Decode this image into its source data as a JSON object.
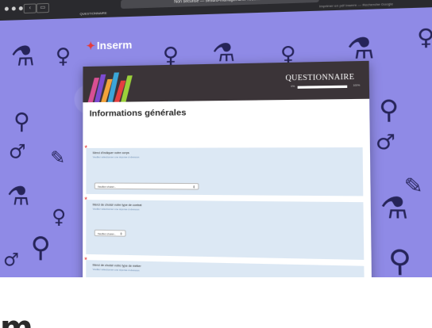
{
  "browser": {
    "url": "Non sécurisé — sesurb-manager.univ-rouen.fr",
    "tab_label": "QUESTIONNAIRE",
    "right_tab_label": "Imprimer en pdf Inserm — Recherche Google"
  },
  "site": {
    "logo_text": "Inserm",
    "logo_mark": "✦"
  },
  "header": {
    "title": "QUESTIONNAIRE",
    "progress_min": "0%",
    "progress_max": "100%",
    "progress": 0
  },
  "main": {
    "section_title": "Informations générales",
    "questions": [
      {
        "label": "Merci d'indiquer votre corps",
        "hint": "Veuillez sélectionner une réponse ci-dessous",
        "select_value": "Veuillez choisir..."
      },
      {
        "label": "Merci de choisir votre type de contrat",
        "hint": "Veuillez sélectionner une réponse ci-dessous",
        "select_value": "Veuillez choisir..."
      },
      {
        "label": "Merci de choisir votre type de métier",
        "hint": "Veuillez sélectionner une réponse ci-dessous",
        "select_value": "Veuillez choisir..."
      }
    ]
  },
  "footer": {
    "mark": "m"
  },
  "colors": {
    "background": "#8f8ae6",
    "header": "#3b3438",
    "question_bg": "#dce8f4",
    "required": "#e02020"
  },
  "icons": [
    "flask-icon",
    "female-symbol-icon",
    "male-symbol-icon",
    "magnifier-icon",
    "pipette-icon"
  ]
}
